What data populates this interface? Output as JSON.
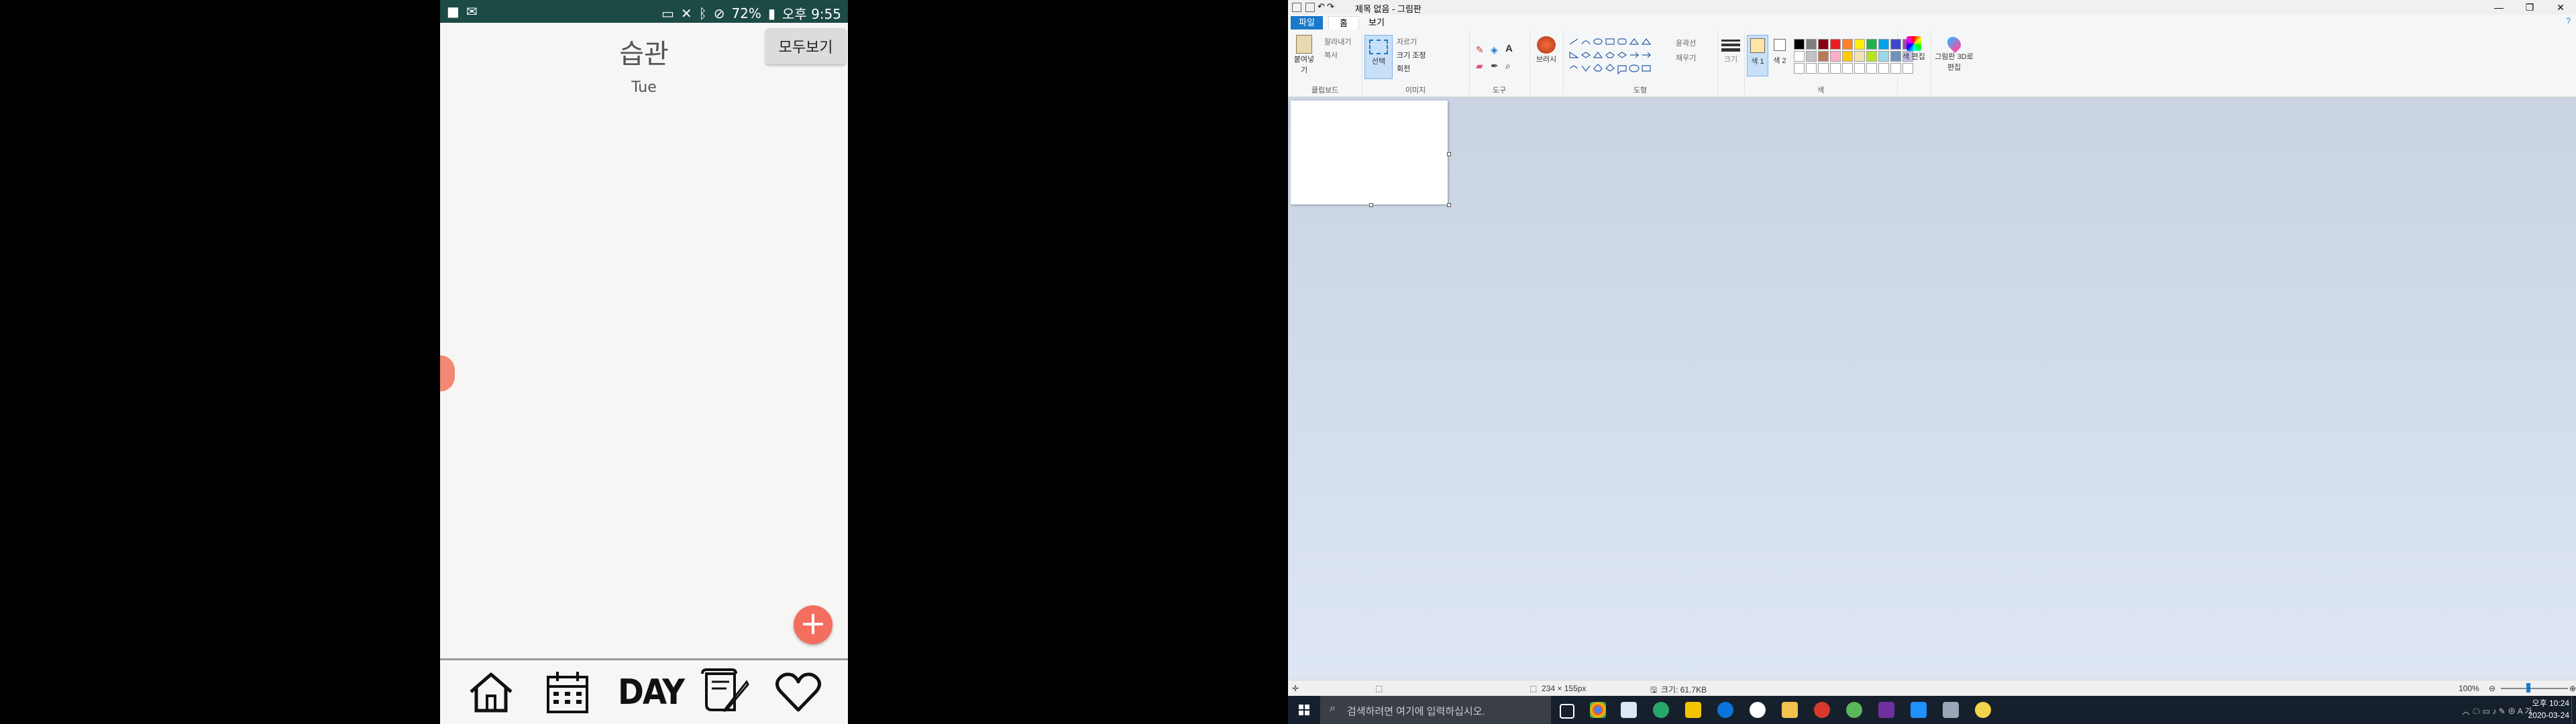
{
  "phone": {
    "status_time": "오후 9:55",
    "battery": "72%",
    "title": "습관",
    "day": "Tue",
    "view_all": "모두보기",
    "fab": "+",
    "nav_day": "DAY"
  },
  "paint": {
    "title": "제목 없음 - 그림판",
    "tabs": {
      "file": "파일",
      "home": "홈",
      "view": "보기"
    },
    "ribbon": {
      "paste": "붙여넣기",
      "cut": "잘라내기",
      "copy": "복사",
      "clipboard": "클립보드",
      "select": "선택",
      "crop": "자르기",
      "resize": "크기 조정",
      "rotate": "회전",
      "image": "이미지",
      "tools": "도구",
      "brushes": "브러시",
      "outline": "윤곽선",
      "fill": "채우기",
      "shapes": "도형",
      "size": "크기",
      "color1": "색 1",
      "color2": "색 2",
      "edit_colors": "색 편집",
      "paint3d": "그림판 3D로 편집",
      "colors": "색",
      "palette": [
        "#000000",
        "#7f7f7f",
        "#880015",
        "#ed1c24",
        "#ff7f27",
        "#fff200",
        "#22b14c",
        "#00a2e8",
        "#3f48cc",
        "#a349a4",
        "#ffffff",
        "#c3c3c3",
        "#b97a57",
        "#ffaec9",
        "#ffc90e",
        "#efe4b0",
        "#b5e61d",
        "#99d9ea",
        "#7092be",
        "#c8bfe7"
      ],
      "color1_value": "#ffe4a8",
      "color2_value": "#ffffff"
    },
    "status": {
      "dimensions": "234 × 155px",
      "filesize": "크기: 61.7KB",
      "zoom": "100%"
    },
    "taskbar": {
      "search_placeholder": "검색하려면 여기에 입력하십시오.",
      "time": "오후 10:24",
      "date": "2020-03-24"
    }
  }
}
